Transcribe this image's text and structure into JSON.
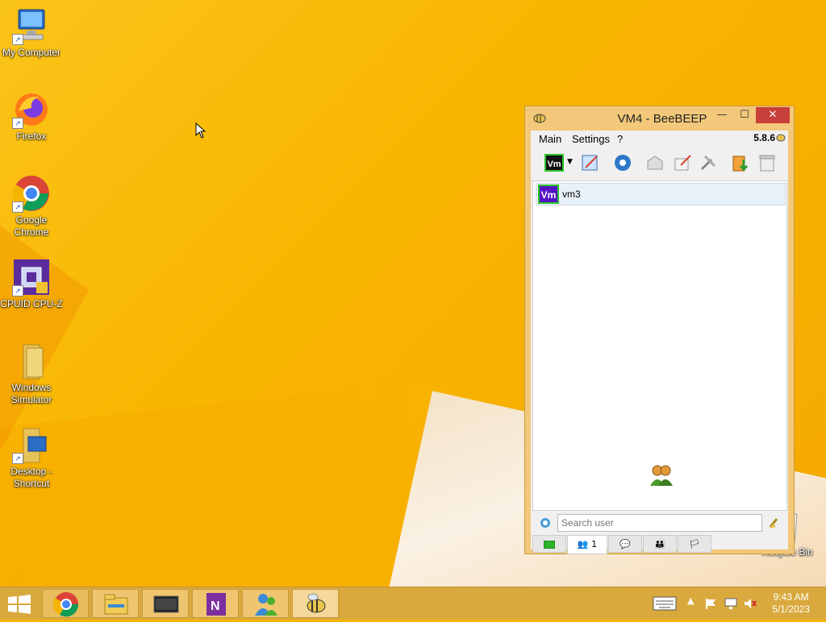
{
  "desktop": {
    "icons": [
      {
        "label": "My Computer",
        "icon": "my-computer-icon"
      },
      {
        "label": "Firefox",
        "icon": "firefox-icon"
      },
      {
        "label": "Google Chrome",
        "icon": "chrome-icon"
      },
      {
        "label": "CPUID CPU-Z",
        "icon": "cpuz-icon"
      },
      {
        "label": "Windows Simulator",
        "icon": "folder-icon"
      },
      {
        "label": "Desktop - Shortcut",
        "icon": "desktop-shortcut-icon"
      }
    ],
    "recycle_bin": "Recycle Bin"
  },
  "window": {
    "title": "VM4 - BeeBEEP",
    "menu": [
      "Main",
      "Settings",
      "?"
    ],
    "version": "5.8.6",
    "users": [
      {
        "badge": "Vm",
        "name": "vm3"
      }
    ],
    "my_badge": "Vm",
    "search_placeholder": "Search user",
    "tab_count": "1",
    "controls": {
      "minimize": "—",
      "maximize": "☐",
      "close": "✕"
    }
  },
  "taskbar": {
    "apps": [
      "start",
      "chrome",
      "file-explorer",
      "desktop-window",
      "onenote",
      "messenger",
      "beebeep"
    ],
    "time": "9:43 AM",
    "date": "5/1/2023"
  },
  "colors": {
    "badge": "#5512c4",
    "accent": "#c7403a",
    "desktop": "#f8b600"
  }
}
